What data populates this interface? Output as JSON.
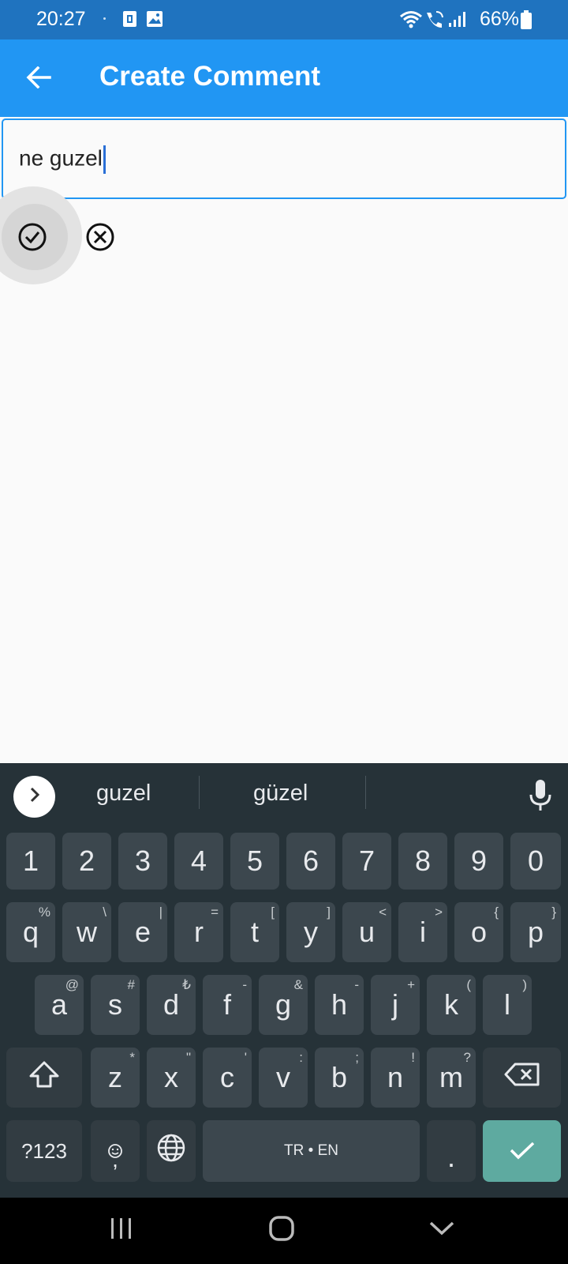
{
  "status_bar": {
    "time": "20:27",
    "battery": "66%",
    "icons": [
      "sim-card-icon",
      "gallery-icon",
      "wifi-icon",
      "wifi-call-icon",
      "signal-icon",
      "battery-icon"
    ]
  },
  "app_bar": {
    "title": "Create Comment",
    "back_icon": "arrow-left-icon",
    "color": "#2196f3"
  },
  "comment_input": {
    "value": "ne guzel"
  },
  "actions": {
    "confirm_icon": "check-circle-icon",
    "cancel_icon": "close-circle-icon"
  },
  "keyboard": {
    "suggestions": [
      "guzel",
      "güzel"
    ],
    "number_row": [
      "1",
      "2",
      "3",
      "4",
      "5",
      "6",
      "7",
      "8",
      "9",
      "0"
    ],
    "row1": [
      {
        "key": "q",
        "sub": "%"
      },
      {
        "key": "w",
        "sub": "\\"
      },
      {
        "key": "e",
        "sub": "|"
      },
      {
        "key": "r",
        "sub": "="
      },
      {
        "key": "t",
        "sub": "["
      },
      {
        "key": "y",
        "sub": "]"
      },
      {
        "key": "u",
        "sub": "<"
      },
      {
        "key": "i",
        "sub": ">"
      },
      {
        "key": "o",
        "sub": "{"
      },
      {
        "key": "p",
        "sub": "}"
      }
    ],
    "row2": [
      {
        "key": "a",
        "sub": "@"
      },
      {
        "key": "s",
        "sub": "#"
      },
      {
        "key": "d",
        "sub": "₺"
      },
      {
        "key": "f",
        "sub": "-"
      },
      {
        "key": "g",
        "sub": "&"
      },
      {
        "key": "h",
        "sub": "-"
      },
      {
        "key": "j",
        "sub": "+"
      },
      {
        "key": "k",
        "sub": "("
      },
      {
        "key": "l",
        "sub": ")"
      }
    ],
    "row3": [
      {
        "key": "z",
        "sub": "*"
      },
      {
        "key": "x",
        "sub": "\""
      },
      {
        "key": "c",
        "sub": "'"
      },
      {
        "key": "v",
        "sub": ":"
      },
      {
        "key": "b",
        "sub": ";"
      },
      {
        "key": "n",
        "sub": "!"
      },
      {
        "key": "m",
        "sub": "?"
      }
    ],
    "symbols_key": "?123",
    "comma_key": ",",
    "space_label": "TR • EN",
    "period_key": ".",
    "enter_color": "#5eaaa0"
  },
  "nav_bar": {
    "icons": [
      "recent-apps-icon",
      "home-icon",
      "back-chevron-icon"
    ]
  }
}
